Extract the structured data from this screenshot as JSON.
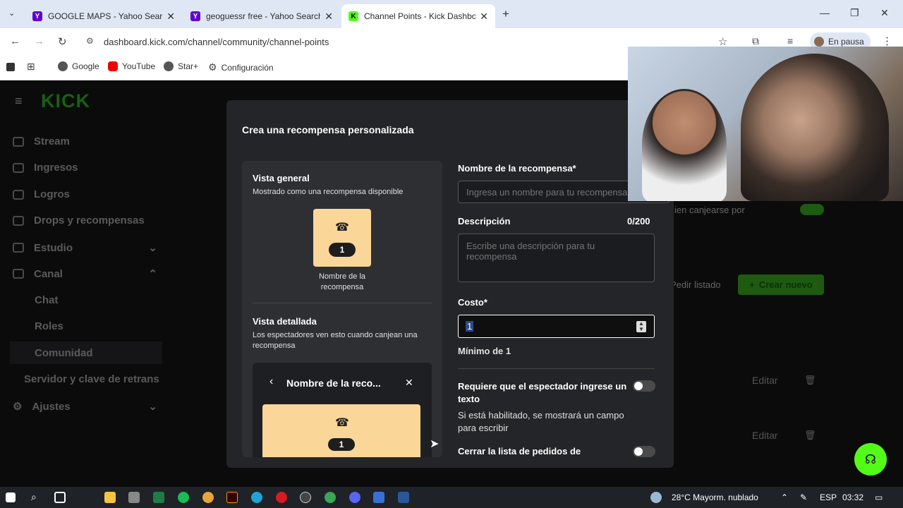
{
  "tabs": [
    {
      "title": "GOOGLE MAPS - Yahoo Search",
      "favicon": "Y",
      "color": "#6001d2"
    },
    {
      "title": "geoguessr free - Yahoo Search",
      "favicon": "Y",
      "color": "#6001d2"
    },
    {
      "title": "Channel Points - Kick Dashboar",
      "favicon": "K",
      "color": "#53fc18"
    }
  ],
  "address": {
    "url": "dashboard.kick.com/channel/community/channel-points",
    "profile": "En pausa"
  },
  "bookmarks": [
    {
      "label": "Google",
      "icon": "google-icon"
    },
    {
      "label": "YouTube",
      "icon": "youtube-icon"
    },
    {
      "label": "Star+",
      "icon": "star-plus-icon"
    },
    {
      "label": "Configuración",
      "icon": "gear-icon"
    }
  ],
  "sidebar": {
    "logo": "KICK",
    "items": [
      {
        "label": "Stream",
        "icon": "broadcast-icon"
      },
      {
        "label": "Ingresos",
        "icon": "chart-icon"
      },
      {
        "label": "Logros",
        "icon": "trophy-icon"
      },
      {
        "label": "Drops y recompensas",
        "icon": "gift-icon"
      },
      {
        "label": "Estudio",
        "icon": "studio-icon",
        "chevron": "down"
      },
      {
        "label": "Canal",
        "icon": "channel-icon",
        "chevron": "up"
      }
    ],
    "subitems": [
      "Chat",
      "Roles",
      "Comunidad",
      "Servidor y clave de retrans"
    ],
    "settings": "Ajustes"
  },
  "background": {
    "redeem_label": "ien canjearse por",
    "request_list": "Pedir listado",
    "create_new": "Crear nuevo",
    "edit_labels": [
      "Editar",
      "Editar"
    ]
  },
  "modal": {
    "title": "Crea una recompensa personalizada",
    "overview_title": "Vista general",
    "overview_sub": "Mostrado como una recompensa disponible",
    "reward_name_preview": "Nombre de la recompensa",
    "cost_badge": "1",
    "detailed_title": "Vista detallada",
    "detailed_sub": "Los espectadores ven esto cuando canjean una recompensa",
    "detail_header": "Nombre de la reco...",
    "fields": {
      "name_label": "Nombre de la recompensa*",
      "name_placeholder": "Ingresa un nombre para tu recompensa",
      "desc_label": "Descripción",
      "desc_count": "0/200",
      "desc_placeholder": "Escribe una descripción para tu recompensa",
      "cost_label": "Costo*",
      "cost_value": "1",
      "cost_min": "Mínimo de 1",
      "text_label": "Requiere que el espectador ingrese un texto",
      "text_help": "Si está habilitado, se mostrará un campo para escribir",
      "close_label": "Cerrar la lista de pedidos de"
    }
  },
  "taskbar": {
    "weather": "28°C  Mayorm. nublado",
    "lang": "ESP",
    "time": "03:32"
  },
  "colors": {
    "kick_green": "#53fc18",
    "card": "#fbd699"
  }
}
